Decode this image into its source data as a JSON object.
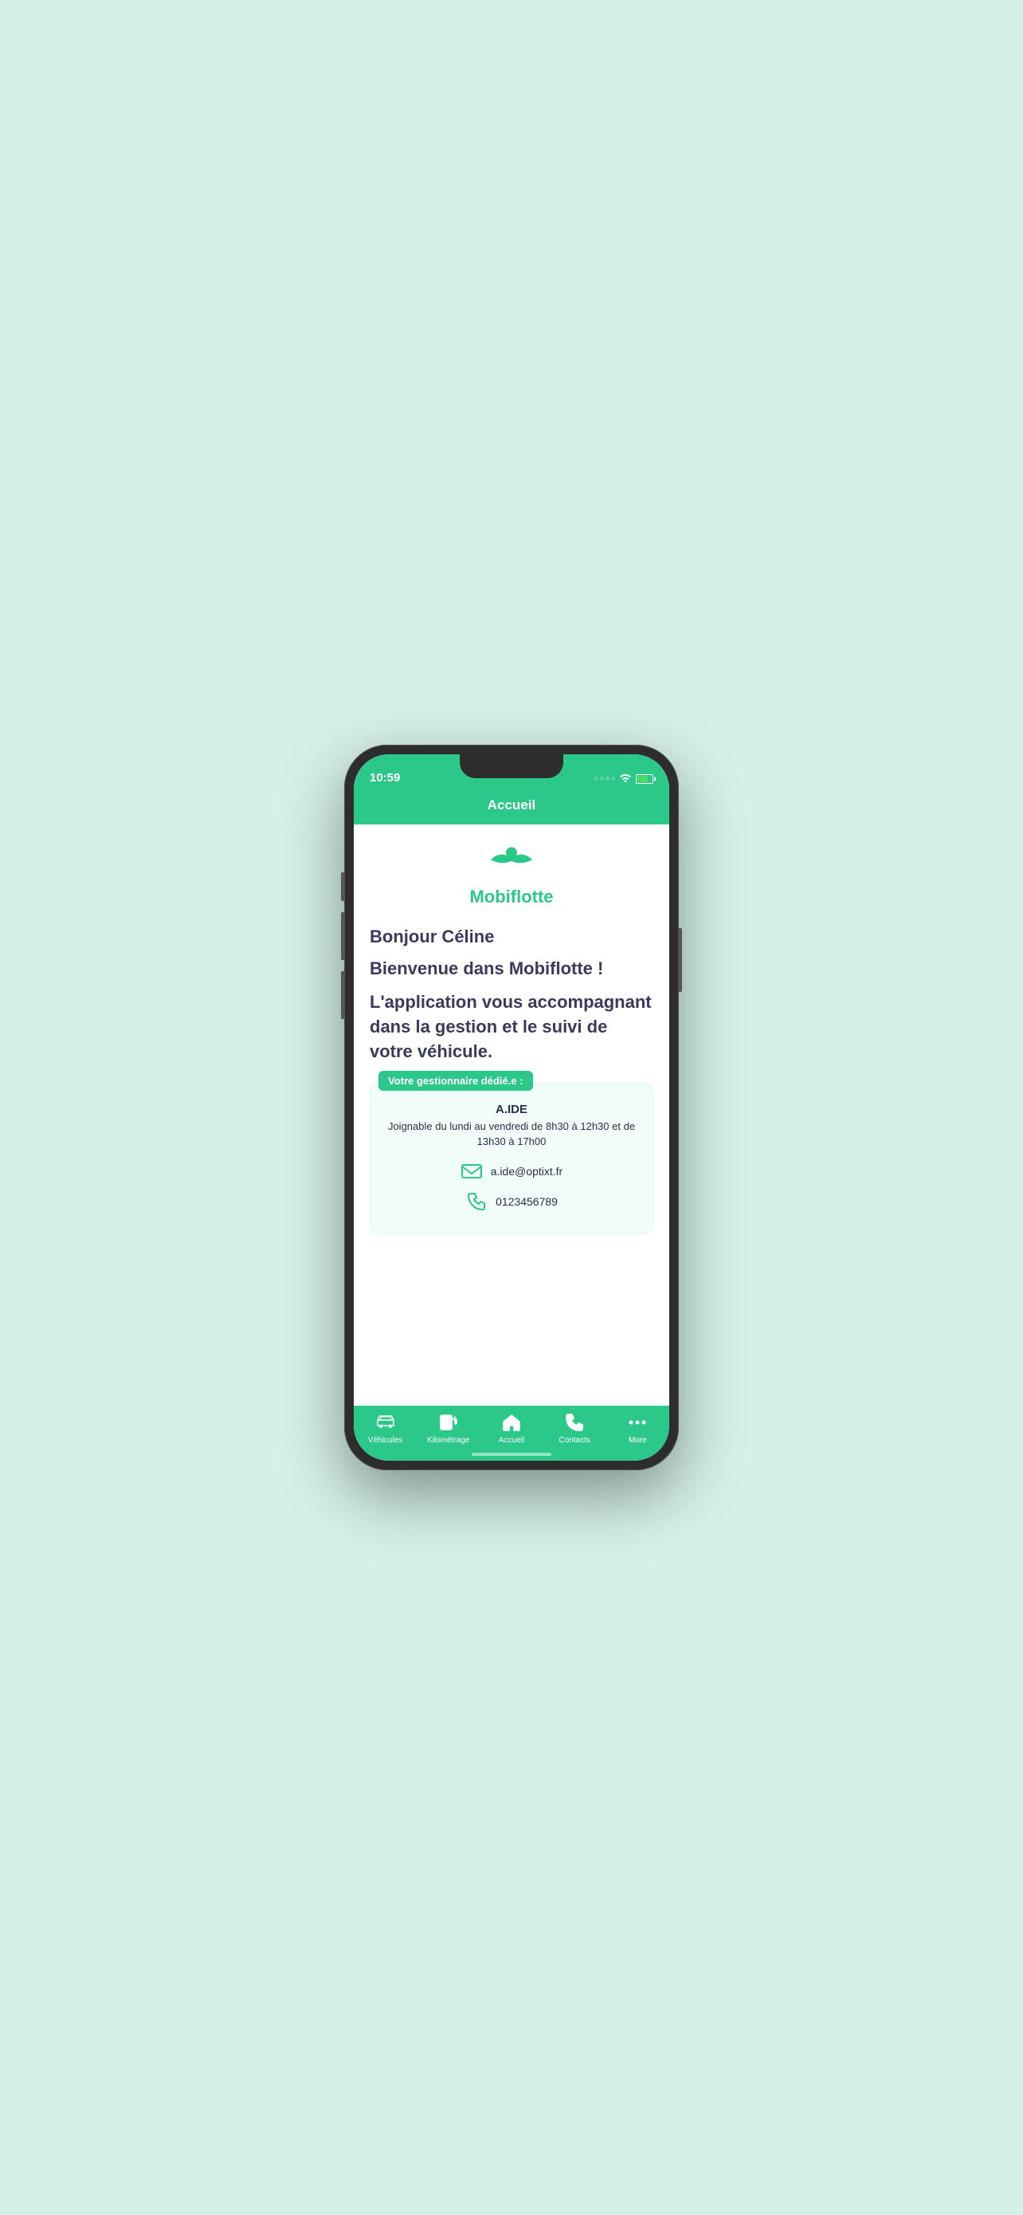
{
  "status_bar": {
    "time": "10:59"
  },
  "header": {
    "title": "Accueil"
  },
  "logo": {
    "text": "Mobiflotte"
  },
  "content": {
    "greeting": "Bonjour Céline",
    "welcome": "Bienvenue dans Mobiflotte !",
    "description": "L'application vous accompagnant dans la gestion et le suivi de votre véhicule."
  },
  "manager_card": {
    "badge": "Votre gestionnaire dédié.e :",
    "name": "A.IDE",
    "hours": "Joignable du lundi au vendredi de 8h30 à 12h30 et de 13h30 à 17h00",
    "email": "a.ide@optixt.fr",
    "phone": "0123456789"
  },
  "tab_bar": {
    "items": [
      {
        "label": "Véhicules",
        "icon": "car"
      },
      {
        "label": "Kilométrage",
        "icon": "fuel"
      },
      {
        "label": "Accueil",
        "icon": "home",
        "active": true
      },
      {
        "label": "Contacts",
        "icon": "phone"
      },
      {
        "label": "More",
        "icon": "more"
      }
    ]
  },
  "colors": {
    "brand_green": "#2bc88a",
    "dark_navy": "#3a3a5c",
    "light_bg": "#f0fdf8"
  }
}
